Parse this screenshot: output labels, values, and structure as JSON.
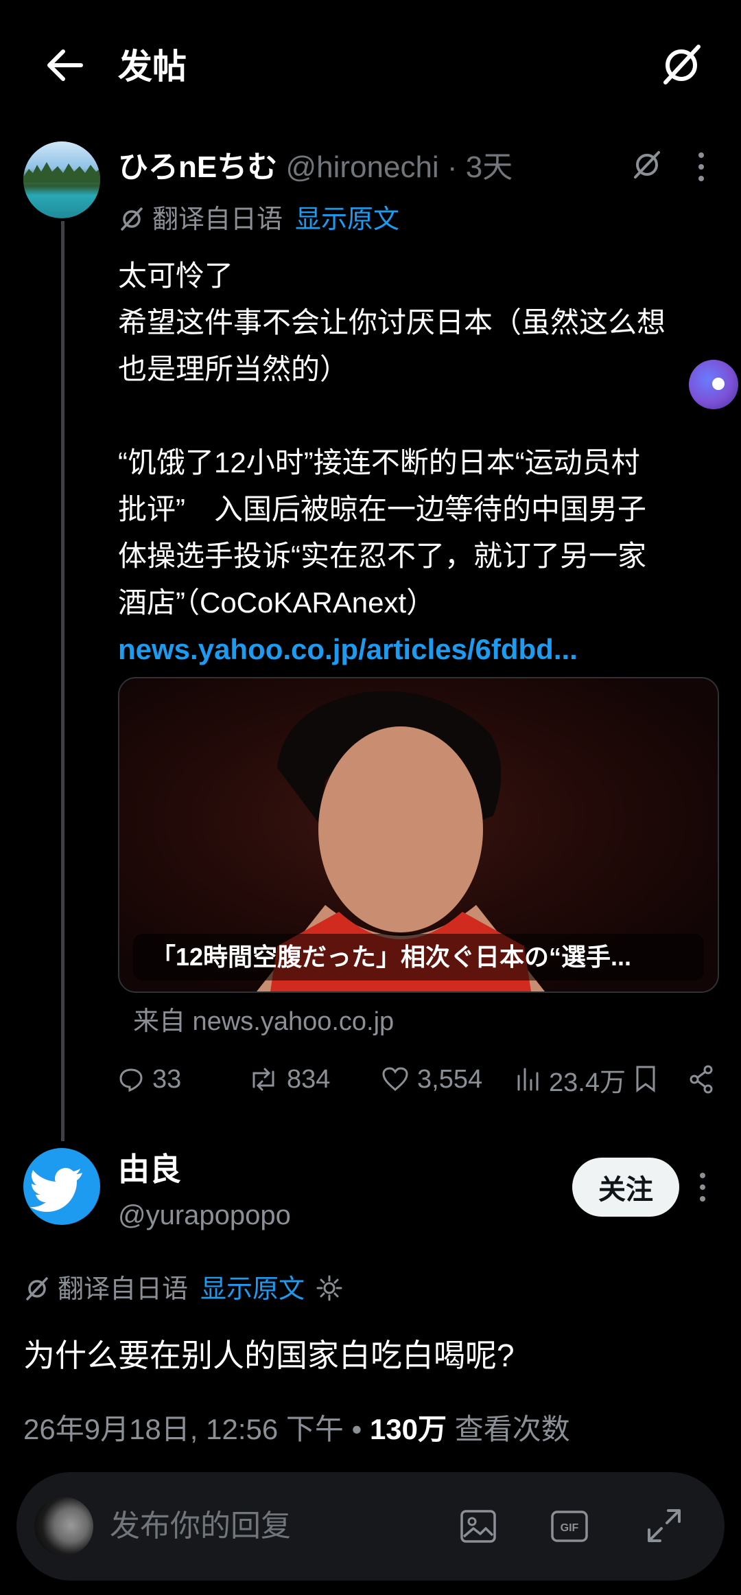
{
  "header": {
    "title": "发帖"
  },
  "post1": {
    "author_name": "ひろnEちむ",
    "handle": "@hironechi",
    "time_sep": " · 3天",
    "translate_label": "翻译自日语",
    "show_original": "显示原文",
    "lines": [
      "太可怜了",
      "希望这件事不会让你讨厌日本（虽然这么想",
      "也是理所当然的）",
      "",
      "“饥饿了12小时”接连不断的日本“运动员村",
      "批评”　入国后被晾在一边等待的中国男子",
      "体操选手投诉“实在忍不了，就订了另一家",
      "酒店”（CoCoKARAnext）"
    ],
    "link_text": "news.yahoo.co.jp/articles/6fdbd...",
    "card": {
      "caption": "「12時間空腹だった」相次ぐ日本の“選手...",
      "source": "来自 news.yahoo.co.jp"
    },
    "stats": {
      "replies": "33",
      "reposts": "834",
      "likes": "3,554",
      "views": "23.4万"
    }
  },
  "post2": {
    "author_name": "由良",
    "handle": "@yurapopopo",
    "follow_label": "关注",
    "translate_label": "翻译自日语",
    "show_original": "显示原文",
    "text": "为什么要在别人的国家白吃白喝呢?",
    "date": "26年9月18日, 12:56 下午 • ",
    "views_count": "130万",
    "views_label": " 查看次数"
  },
  "reply_bar": {
    "placeholder": "发布你的回复",
    "gif_label": "GIF"
  },
  "colors": {
    "accent": "#1d9bf0",
    "background": "#000000",
    "muted": "#71767b"
  }
}
